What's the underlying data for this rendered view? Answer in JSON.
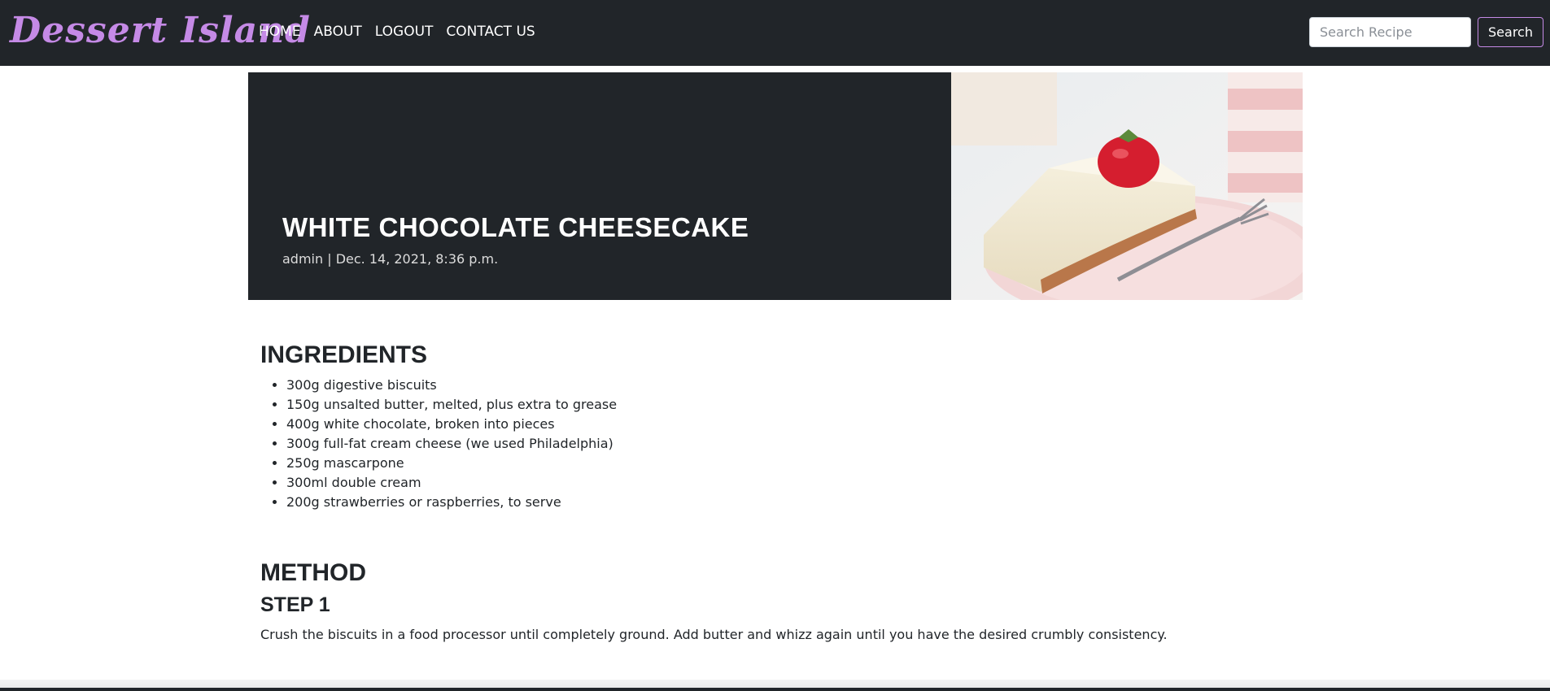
{
  "navbar": {
    "brand": "Dessert Island",
    "links": [
      "HOME",
      "ABOUT",
      "LOGOUT",
      "CONTACT US"
    ],
    "search": {
      "placeholder": "Search Recipe",
      "value": "",
      "button_label": "Search"
    }
  },
  "recipe": {
    "title": "WHITE CHOCOLATE CHEESECAKE",
    "meta": "admin | Dec. 14, 2021, 8:36 p.m."
  },
  "ingredients": {
    "heading": "INGREDIENTS",
    "items": [
      "300g digestive biscuits",
      "150g unsalted butter, melted, plus extra to grease",
      "400g white chocolate, broken into pieces",
      "300g full-fat cream cheese (we used Philadelphia)",
      "250g mascarpone",
      "300ml double cream",
      "200g strawberries or raspberries, to serve"
    ]
  },
  "method": {
    "heading": "METHOD",
    "steps": [
      {
        "label": "STEP 1",
        "text": "Crush the biscuits in a food processor until completely ground. Add butter and whizz again until you have the desired crumbly consistency."
      }
    ]
  },
  "colors": {
    "nav_bg": "#212529",
    "brand": "#c58ae6",
    "hero_bg": "#212529"
  }
}
